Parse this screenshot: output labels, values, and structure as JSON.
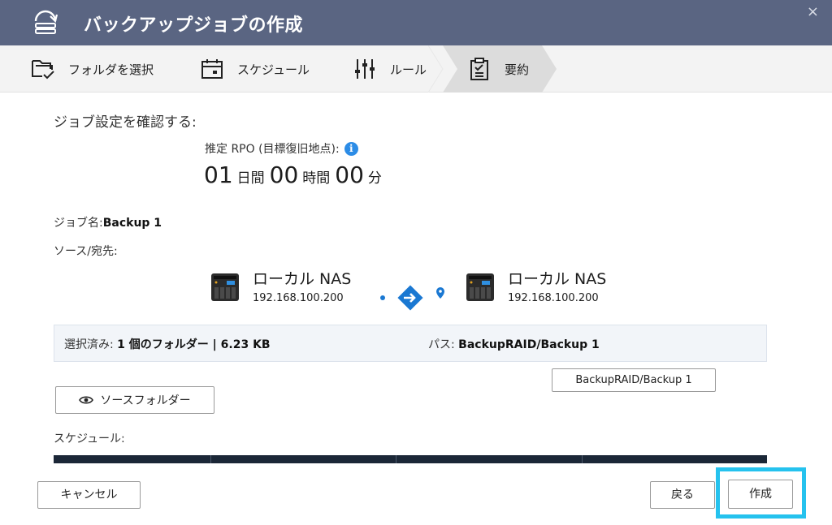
{
  "window": {
    "title": "バックアップジョブの作成",
    "close_glyph": "×"
  },
  "steps": [
    {
      "label": "フォルダを選択",
      "icon": "folder-select-icon"
    },
    {
      "label": "スケジュール",
      "icon": "calendar-icon"
    },
    {
      "label": "ルール",
      "icon": "sliders-icon"
    },
    {
      "label": "要約",
      "icon": "clipboard-icon",
      "active": true
    }
  ],
  "summary": {
    "heading": "ジョブ設定を確認する:",
    "rpo_label": "推定 RPO (目標復旧地点):",
    "info_glyph": "i",
    "rpo": {
      "days": "01",
      "days_unit": "日間",
      "hours": "00",
      "hours_unit": "時間",
      "minutes": "00",
      "minutes_unit": "分"
    },
    "job_name_label": "ジョブ名:",
    "job_name": "Backup 1",
    "source_dest_label": "ソース/宛先:",
    "source": {
      "name": "ローカル NAS",
      "ip": "192.168.100.200"
    },
    "destination": {
      "name": "ローカル NAS",
      "ip": "192.168.100.200"
    },
    "selected_label": "選択済み:",
    "selected_value": "1 個のフォルダー | 6.23 KB",
    "path_label": "パス:",
    "path_value": "BackupRAID/Backup 1",
    "path_button": "BackupRAID/Backup 1",
    "source_folder_button": "ソースフォルダー",
    "schedule_label": "スケジュール:"
  },
  "footer": {
    "cancel": "キャンセル",
    "back": "戻る",
    "create": "作成"
  },
  "colors": {
    "titlebar": "#5a6582",
    "accent_blue": "#1a78d2",
    "highlight": "#25c2ee",
    "table_header": "#1b2737"
  }
}
